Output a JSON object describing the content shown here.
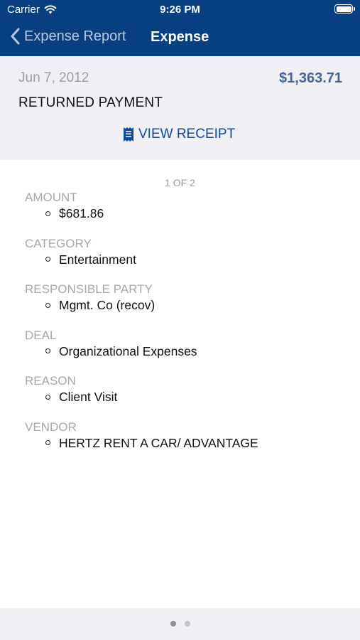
{
  "status_bar": {
    "carrier": "Carrier",
    "time": "9:26 PM"
  },
  "nav": {
    "back_label": "Expense Report",
    "title": "Expense"
  },
  "summary": {
    "date": "Jun 7, 2012",
    "total": "$1,363.71",
    "payee": "RETURNED PAYMENT",
    "receipt_label": "VIEW RECEIPT"
  },
  "detail": {
    "page_indicator": "1 OF 2",
    "fields": [
      {
        "label": "AMOUNT",
        "value": "$681.86"
      },
      {
        "label": "CATEGORY",
        "value": "Entertainment"
      },
      {
        "label": "RESPONSIBLE PARTY",
        "value": "Mgmt. Co (recov)"
      },
      {
        "label": "DEAL",
        "value": "Organizational Expenses"
      },
      {
        "label": "REASON",
        "value": "Client Visit"
      },
      {
        "label": "VENDOR",
        "value": "HERTZ RENT A CAR/ ADVANTAGE"
      }
    ]
  },
  "pager": {
    "total_pages": 2,
    "current_page": 1
  },
  "colors": {
    "nav_background": "#073f80",
    "accent": "#0d4aa0",
    "total_amount": "#46648f",
    "muted_text": "#9c9ca3",
    "summary_background": "#efeff4"
  },
  "icons": {
    "back": "chevron-left-icon",
    "receipt": "receipt-icon",
    "wifi": "wifi-icon",
    "battery": "battery-icon"
  }
}
